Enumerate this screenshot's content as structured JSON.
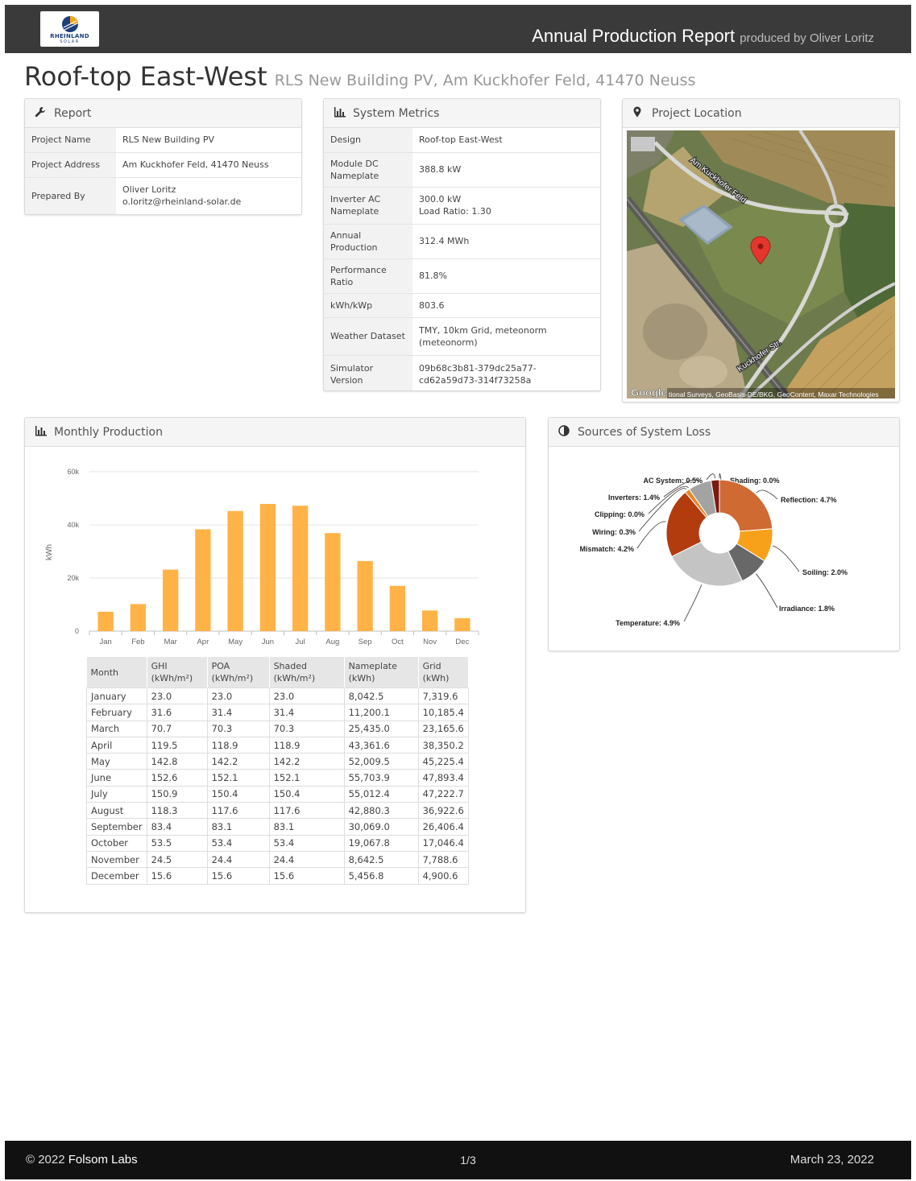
{
  "header": {
    "logo_line1": "RHEINLAND",
    "logo_line2": "SOLAR",
    "title": "Annual Production Report",
    "subtitle": "produced by Oliver Loritz"
  },
  "page": {
    "title": "Roof-top East-West",
    "address": "RLS New Building PV, Am Kuckhofer Feld, 41470 Neuss"
  },
  "report": {
    "heading": "Report",
    "rows": [
      {
        "key": "Project Name",
        "value": "RLS New Building PV"
      },
      {
        "key": "Project Address",
        "value": "Am Kuckhofer Feld, 41470 Neuss"
      },
      {
        "key": "Prepared By",
        "value": "Oliver Loritz",
        "value2": "o.loritz@rheinland-solar.de"
      }
    ]
  },
  "metrics": {
    "heading": "System Metrics",
    "rows": [
      {
        "key": "Design",
        "value": "Roof-top East-West"
      },
      {
        "key": "Module DC Nameplate",
        "value": "388.8 kW"
      },
      {
        "key": "Inverter AC Nameplate",
        "value": "300.0 kW",
        "value2": "Load Ratio: 1.30"
      },
      {
        "key": "Annual Production",
        "value": "312.4 MWh"
      },
      {
        "key": "Performance Ratio",
        "value": "81.8%"
      },
      {
        "key": "kWh/kWp",
        "value": "803.6"
      },
      {
        "key": "Weather Dataset",
        "value": "TMY, 10km Grid, meteonorm (meteonorm)"
      },
      {
        "key": "Simulator Version",
        "value": "09b68c3b81-379dc25a77-cd62a59d73-314f73258a"
      }
    ]
  },
  "location": {
    "heading": "Project Location",
    "street1": "Am Kuckhofer Feld",
    "street2": "Kuckhofer Str.",
    "google": "Google",
    "attribution": "tional Surveys, GeoBasis-DE/BKG, GeoContent, Maxar Technologies"
  },
  "monthly": {
    "heading": "Monthly Production",
    "columns": [
      "Month",
      "GHI",
      "(kWh/m²)",
      "POA",
      "(kWh/m²)",
      "Shaded",
      "(kWh/m²)",
      "Nameplate",
      "(kWh)",
      "Grid",
      "(kWh)"
    ],
    "rows": [
      [
        "January",
        "23.0",
        "23.0",
        "23.0",
        "8,042.5",
        "7,319.6"
      ],
      [
        "February",
        "31.6",
        "31.4",
        "31.4",
        "11,200.1",
        "10,185.4"
      ],
      [
        "March",
        "70.7",
        "70.3",
        "70.3",
        "25,435.0",
        "23,165.6"
      ],
      [
        "April",
        "119.5",
        "118.9",
        "118.9",
        "43,361.6",
        "38,350.2"
      ],
      [
        "May",
        "142.8",
        "142.2",
        "142.2",
        "52,009.5",
        "45,225.4"
      ],
      [
        "June",
        "152.6",
        "152.1",
        "152.1",
        "55,703.9",
        "47,893.4"
      ],
      [
        "July",
        "150.9",
        "150.4",
        "150.4",
        "55,012.4",
        "47,222.7"
      ],
      [
        "August",
        "118.3",
        "117.6",
        "117.6",
        "42,880.3",
        "36,922.6"
      ],
      [
        "September",
        "83.4",
        "83.1",
        "83.1",
        "30,069.0",
        "26,406.4"
      ],
      [
        "October",
        "53.5",
        "53.4",
        "53.4",
        "19,067.8",
        "17,046.4"
      ],
      [
        "November",
        "24.5",
        "24.4",
        "24.4",
        "8,642.5",
        "7,788.6"
      ],
      [
        "December",
        "15.6",
        "15.6",
        "15.6",
        "5,456.8",
        "4,900.6"
      ]
    ]
  },
  "losses": {
    "heading": "Sources of System Loss"
  },
  "chart_data": [
    {
      "type": "bar",
      "ylabel": "kWh",
      "ylim": [
        0,
        60000
      ],
      "yticks": [
        0,
        20000,
        40000,
        60000
      ],
      "ytick_labels": [
        "0",
        "20k",
        "40k",
        "60k"
      ],
      "categories": [
        "Jan",
        "Feb",
        "Mar",
        "Apr",
        "May",
        "Jun",
        "Jul",
        "Aug",
        "Sep",
        "Oct",
        "Nov",
        "Dec"
      ],
      "values": [
        7319.6,
        10185.4,
        23165.6,
        38350.2,
        45225.4,
        47893.4,
        47222.7,
        36922.6,
        26406.4,
        17046.4,
        7788.6,
        4900.6
      ],
      "color": "#ffb347",
      "grid": true
    },
    {
      "type": "pie",
      "donut": true,
      "slices": [
        {
          "label": "Shading",
          "value": 0.0,
          "text": "Shading: 0.0%",
          "color": "#c9c9c9"
        },
        {
          "label": "Reflection",
          "value": 4.7,
          "text": "Reflection: 4.7%",
          "color": "#cf6a33"
        },
        {
          "label": "Soiling",
          "value": 2.0,
          "text": "Soiling: 2.0%",
          "color": "#f7a11a"
        },
        {
          "label": "Irradiance",
          "value": 1.8,
          "text": "Irradiance: 1.8%",
          "color": "#686868"
        },
        {
          "label": "Temperature",
          "value": 4.9,
          "text": "Temperature: 4.9%",
          "color": "#c4c4c4"
        },
        {
          "label": "Mismatch",
          "value": 4.2,
          "text": "Mismatch: 4.2%",
          "color": "#b33c0f"
        },
        {
          "label": "Wiring",
          "value": 0.3,
          "text": "Wiring: 0.3%",
          "color": "#e58a2c"
        },
        {
          "label": "Clipping",
          "value": 0.0,
          "text": "Clipping: 0.0%",
          "color": "#888888"
        },
        {
          "label": "Inverters",
          "value": 1.4,
          "text": "Inverters: 1.4%",
          "color": "#a3a3a3"
        },
        {
          "label": "AC System",
          "value": 0.5,
          "text": "AC System: 0.5%",
          "color": "#7a1a0e"
        }
      ]
    }
  ],
  "footer": {
    "copyright": "© 2022 ",
    "company": "Folsom Labs",
    "page": "1/3",
    "date": "March 23, 2022"
  }
}
